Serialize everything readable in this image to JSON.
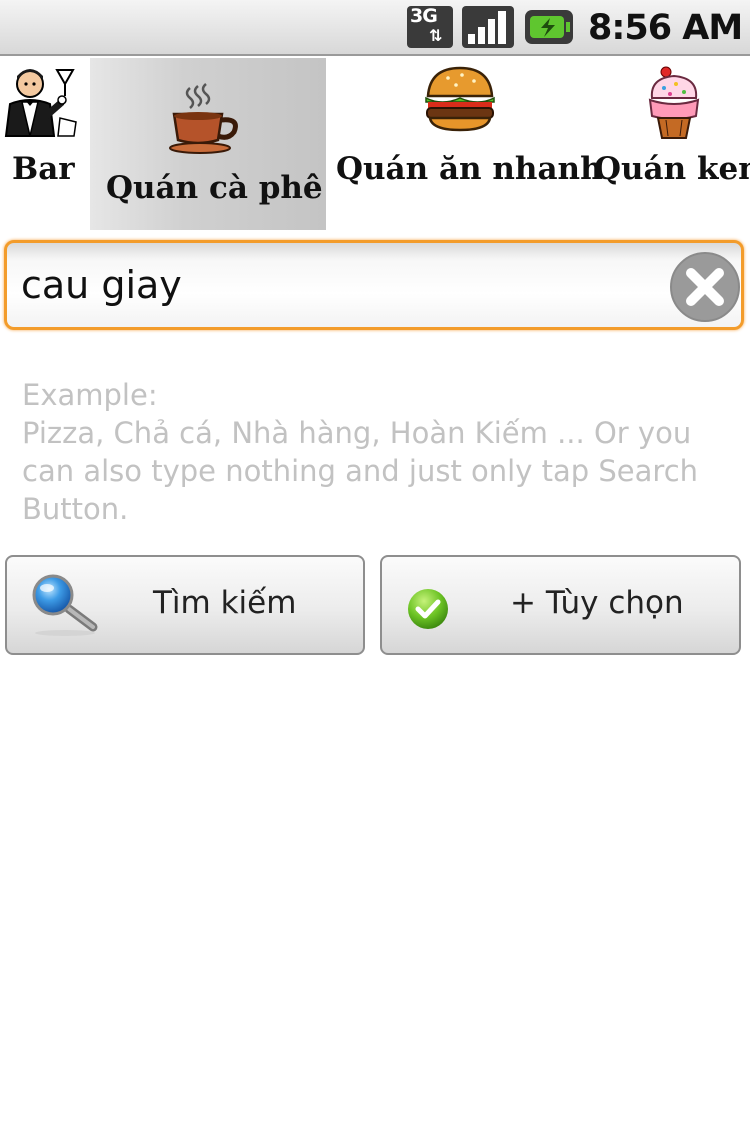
{
  "status_bar": {
    "network_label": "3G",
    "time": "8:56 AM",
    "icons": [
      "3g-icon",
      "signal-icon",
      "battery-charging-icon"
    ]
  },
  "categories": [
    {
      "label": "Bar",
      "icon": "bartender-icon",
      "selected": false
    },
    {
      "label": "Quán cà phê",
      "icon": "coffee-cup-icon",
      "selected": true
    },
    {
      "label": "Quán ăn nhanh",
      "icon": "burger-icon",
      "selected": false
    },
    {
      "label": "Quán kem",
      "icon": "ice-cream-icon",
      "selected": false
    }
  ],
  "search": {
    "value": "cau giay",
    "clear_icon": "clear-icon"
  },
  "hint": {
    "title": "Example:",
    "line1": "Pizza, Chả cá, Nhà hàng, Hoàn Kiếm ... Or you",
    "line2": "can also type nothing and just only tap Search",
    "line3": "Button."
  },
  "buttons": {
    "search_label": "Tìm kiếm",
    "options_label": "+ Tùy chọn"
  },
  "colors": {
    "focus_border": "#f39c2b",
    "hint_text": "#c2c2c2",
    "check_green": "#6cc324",
    "search_blue": "#2f8fe0"
  }
}
